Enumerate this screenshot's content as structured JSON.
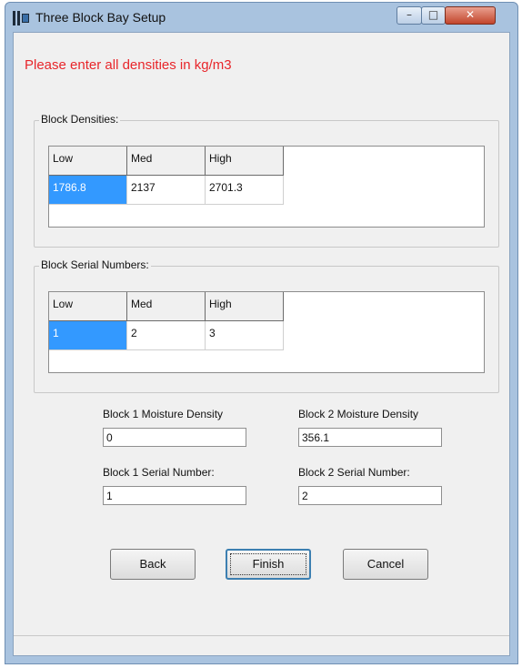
{
  "window": {
    "title": "Three Block Bay Setup",
    "controls": {
      "minimize": "–",
      "maximize": "□",
      "close": "✕"
    }
  },
  "instruction": "Please enter all densities in kg/m3",
  "densities": {
    "legend": "Block Densities:",
    "headers": [
      "Low",
      "Med",
      "High"
    ],
    "values": [
      "1786.8",
      "2137",
      "2701.3"
    ]
  },
  "serials": {
    "legend": "Block Serial Numbers:",
    "headers": [
      "Low",
      "Med",
      "High"
    ],
    "values": [
      "1",
      "2",
      "3"
    ]
  },
  "fields": {
    "block1_moisture": {
      "label": "Block 1 Moisture Density",
      "value": "0"
    },
    "block2_moisture": {
      "label": "Block 2 Moisture Density",
      "value": "356.1"
    },
    "block1_serial": {
      "label": "Block 1 Serial Number:",
      "value": "1"
    },
    "block2_serial": {
      "label": "Block 2 Serial Number:",
      "value": "2"
    }
  },
  "buttons": {
    "back": "Back",
    "finish": "Finish",
    "cancel": "Cancel"
  },
  "colors": {
    "instruction": "#e8262b",
    "selection": "#3399ff"
  }
}
